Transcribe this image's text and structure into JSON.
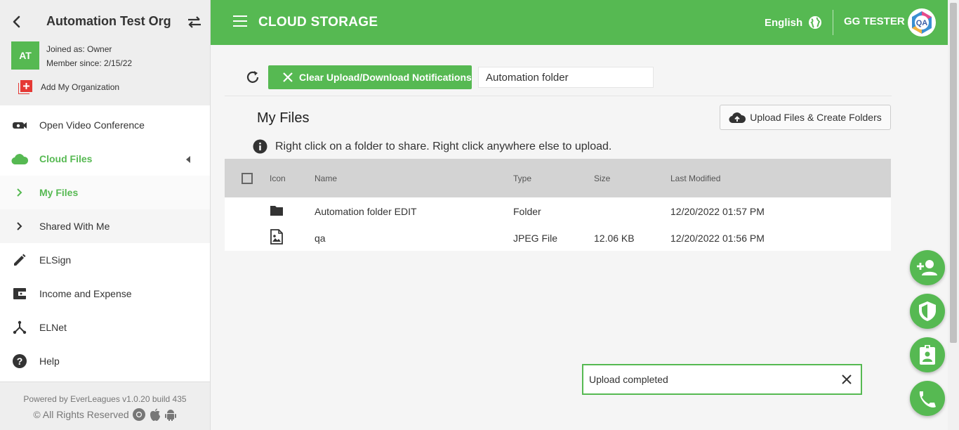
{
  "sidebar": {
    "org_name": "Automation Test Org",
    "avatar_initials": "AT",
    "joined": "Joined as: Owner",
    "member_since": "Member since: 2/15/22",
    "add_org": "Add My Organization",
    "items": [
      {
        "label": "Open Video Conference",
        "icon": "video-camera-icon"
      },
      {
        "label": "Cloud Files",
        "icon": "cloud-icon"
      },
      {
        "label": "My Files",
        "icon": "chevron-right-icon"
      },
      {
        "label": "Shared With Me",
        "icon": "chevron-right-icon"
      },
      {
        "label": "ELSign",
        "icon": "pencil-icon"
      },
      {
        "label": "Income and Expense",
        "icon": "wallet-icon"
      },
      {
        "label": "ELNet",
        "icon": "network-icon"
      },
      {
        "label": "Help",
        "icon": "help-icon"
      }
    ],
    "footer": {
      "powered": "Powered by EverLeagues v1.0.20 build 435",
      "rights": "© All Rights Reserved"
    }
  },
  "header": {
    "title": "CLOUD STORAGE",
    "language": "English",
    "user": "GG TESTER",
    "avatar_text": "QA"
  },
  "toolbar": {
    "clear_label": "Clear Upload/Download Notifications",
    "path_value": "Automation folder"
  },
  "files": {
    "title": "My Files",
    "upload_label": "Upload Files & Create Folders",
    "hint": "Right click on a folder to share. Right click anywhere else to upload.",
    "columns": [
      "Icon",
      "Name",
      "Type",
      "Size",
      "Last Modified"
    ],
    "rows": [
      {
        "name": "Automation folder EDIT",
        "type": "Folder",
        "size": "",
        "modified": "12/20/2022 01:57 PM",
        "icon": "folder-icon"
      },
      {
        "name": "qa",
        "type": "JPEG File",
        "size": "12.06 KB",
        "modified": "12/20/2022 01:56 PM",
        "icon": "image-file-icon"
      }
    ]
  },
  "toast": {
    "message": "Upload completed"
  },
  "colors": {
    "accent": "#56b952"
  }
}
